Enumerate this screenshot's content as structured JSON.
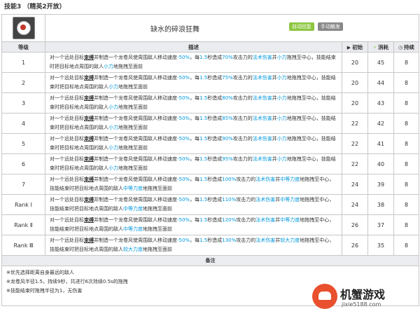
{
  "header": "技能3 （精英2开放）",
  "skill": {
    "name": "缺水的碎浪狂舞",
    "badges": [
      "自动回复",
      "手动触发"
    ]
  },
  "columns": {
    "level": "等级",
    "desc": "描述",
    "init": "初始",
    "cost": "消耗",
    "duration": "持续"
  },
  "rows": [
    {
      "level": "1",
      "desc": [
        "对一个远处目标",
        "束缚",
        "并制造一个龙卷风使周围敌人移动速度",
        "-50%",
        "，每",
        "1.5",
        "秒造成",
        "70%",
        "攻击力的",
        "法术伤害",
        "并",
        "小力",
        "拖拽至中心，技能结束时把目标地点周围的敌人",
        "小力",
        "地拖拽至面前"
      ],
      "init": "20",
      "cost": "45",
      "duration": "8"
    },
    {
      "level": "2",
      "desc": [
        "对一个远处目标",
        "束缚",
        "并制造一个龙卷风使周围敌人移动速度",
        "-50%",
        "，每",
        "1.5",
        "秒造成",
        "75%",
        "攻击力的",
        "法术伤害",
        "并",
        "小力",
        "地拖拽至中心，技能结束时把目标地点周围的敌人",
        "小力",
        "地拖拽至面前"
      ],
      "init": "20",
      "cost": "44",
      "duration": "8"
    },
    {
      "level": "3",
      "desc": [
        "对一个远处目标",
        "束缚",
        "并制造一个龙卷风使周围敌人移动速度",
        "-50%",
        "，每",
        "1.5",
        "秒造成",
        "80%",
        "攻击力的",
        "法术伤害",
        "并",
        "小力",
        "地拖拽至中心，技能结束时把目标地点周围的敌人",
        "小力",
        "地拖拽至面前"
      ],
      "init": "20",
      "cost": "43",
      "duration": "8"
    },
    {
      "level": "4",
      "desc": [
        "对一个远处目标",
        "束缚",
        "并制造一个龙卷风使周围敌人移动速度",
        "-50%",
        "，每",
        "1.5",
        "秒造成",
        "85%",
        "攻击力的",
        "法术伤害",
        "并",
        "小力",
        "地拖拽至中心，技能结束时把目标地点周围的敌人",
        "小力",
        "地拖拽至面前"
      ],
      "init": "22",
      "cost": "42",
      "duration": "8"
    },
    {
      "level": "5",
      "desc": [
        "对一个远处目标",
        "束缚",
        "并制造一个龙卷风使周围敌人移动速度",
        "-50%",
        "，每",
        "1.5",
        "秒造成",
        "90%",
        "攻击力的",
        "法术伤害",
        "并",
        "小力",
        "地拖拽至中心，技能结束时把目标地点周围的敌人",
        "小力",
        "地拖拽至面前"
      ],
      "init": "22",
      "cost": "41",
      "duration": "8"
    },
    {
      "level": "6",
      "desc": [
        "对一个远处目标",
        "束缚",
        "并制造一个龙卷风使周围敌人移动速度",
        "-50%",
        "，每",
        "1.5",
        "秒造成",
        "95%",
        "攻击力的",
        "法术伤害",
        "并",
        "小力",
        "地拖拽至中心，技能结束时把目标地点周围的敌人",
        "小力",
        "地拖拽至面前"
      ],
      "init": "22",
      "cost": "40",
      "duration": "8"
    },
    {
      "level": "7",
      "desc": [
        "对一个远处目标",
        "束缚",
        "并制造一个龙卷风使周围敌人移动速度",
        "-50%",
        "，每",
        "1.5",
        "秒造成",
        "100%",
        "攻击力的",
        "法术伤害",
        "并",
        "中等力度",
        "地拖拽至中心，技能结束时把目标地点周围的敌人",
        "中等力度",
        "地拖拽至面前"
      ],
      "init": "24",
      "cost": "39",
      "duration": "8"
    },
    {
      "level": "Rank Ⅰ",
      "desc": [
        "对一个远处目标",
        "束缚",
        "并制造一个龙卷风使周围敌人移动速度",
        "-50%",
        "，每",
        "1.5",
        "秒造成",
        "110%",
        "攻击力的",
        "法术伤害",
        "并",
        "中等力度",
        "地拖拽至中心，技能结束时把目标地点周围的敌人",
        "中等力度",
        "地拖拽至面前"
      ],
      "init": "24",
      "cost": "38",
      "duration": "8"
    },
    {
      "level": "Rank Ⅱ",
      "desc": [
        "对一个远处目标",
        "束缚",
        "并制造一个龙卷风使周围敌人移动速度",
        "-50%",
        "，每",
        "1.5",
        "秒造成",
        "120%",
        "攻击力的",
        "法术伤害",
        "并",
        "中等力度",
        "地拖拽至中心，技能结束时把目标地点周围的敌人",
        "中等力度",
        "地拖拽至面前"
      ],
      "init": "26",
      "cost": "37",
      "duration": "8"
    },
    {
      "level": "Rank Ⅲ",
      "desc": [
        "对一个远处目标",
        "束缚",
        "并制造一个龙卷风使周围敌人移动速度",
        "-50%",
        "，每",
        "1.5",
        "秒造成",
        "130%",
        "攻击力的",
        "法术伤害",
        "并",
        "较大力度",
        "地拖拽至中心，技能结束时把目标地点周围的敌人",
        "较大力度",
        "地拖拽至面前"
      ],
      "init": "26",
      "cost": "35",
      "duration": "8"
    }
  ],
  "notes_title": "备注",
  "notes": [
    "※优先选择距离自身最远的敌人",
    "※龙卷风半径1.5，持续9秒，共进行6次持续0.5s的拖拽",
    "※技能结束时拖拽半径为1，无伤害"
  ],
  "watermark": {
    "title": "机蟹游戏",
    "url": "jixie5188.com"
  }
}
